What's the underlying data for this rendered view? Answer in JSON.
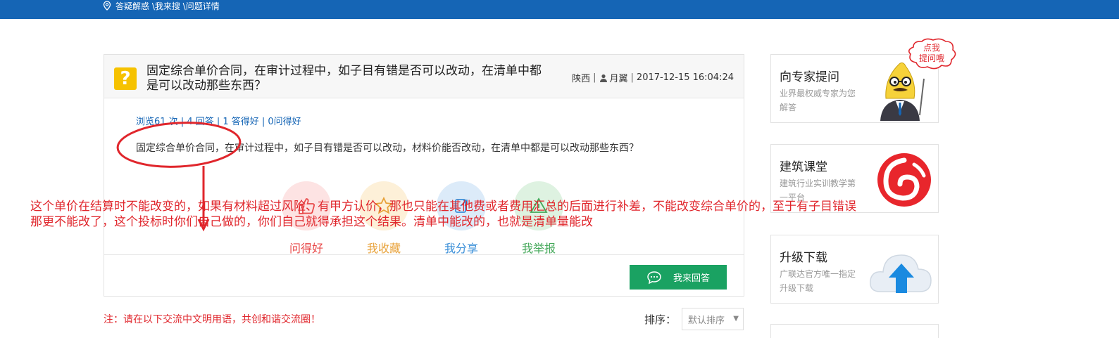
{
  "breadcrumb": {
    "text": "答疑解惑 \\我来搜 \\问题详情"
  },
  "question": {
    "title": "固定综合单价合同，在审计过程中，如子目有错是否可以改动，在清单中都是可以改动那些东西？",
    "region": "陕西",
    "user": "月翼",
    "datetime": "2017-12-15 16:04:24",
    "stats": "浏览61 次 | 4 回答 | 1 答得好 | 0问得好",
    "body": "固定综合单价合同，在审计过程中，如子目有错是否可以改动，材料价能否改动，在清单中都是可以改动那些东西？"
  },
  "actions": [
    {
      "label": "问得好",
      "icon": "thumbs-up-icon",
      "color": "#e84a4a",
      "bg": "#fde3e3"
    },
    {
      "label": "我收藏",
      "icon": "star-icon",
      "color": "#e8a23a",
      "bg": "#fdf0d8"
    },
    {
      "label": "我分享",
      "icon": "share-icon",
      "color": "#3a8fd8",
      "bg": "#dcebf9"
    },
    {
      "label": "我举报",
      "icon": "warning-icon",
      "color": "#45a85a",
      "bg": "#def2e1"
    }
  ],
  "answer_button": {
    "label": "我来回答",
    "icon": "chat-bubble-icon"
  },
  "notice": "注：请在以下交流中文明用语，共创和谐交流圈！",
  "sort": {
    "label": "排序：",
    "selected": "默认排序"
  },
  "sidebar": {
    "bubble": "点我\n提问哦",
    "cards": [
      {
        "title": "向专家提问",
        "subtitle": "业界最权威专家为您解答",
        "icon": "expert-mascot-icon"
      },
      {
        "title": "建筑课堂",
        "subtitle": "建筑行业实训教学第一平台",
        "icon": "glodon-logo-icon"
      },
      {
        "title": "升级下载",
        "subtitle": "广联达官方唯一指定升级下载",
        "icon": "cloud-upload-icon"
      }
    ]
  },
  "annotation": {
    "line1": "这个单价在结算时不能改变的，如果有材料超过风险、有甲方认价，那也只能在其他费或者费用汇总的后面进行补差，不能改变综合单价的，至于有子目错误",
    "line2": "那更不能改了，这个投标时你们自己做的，你们自己就得承担这个结果。清单中能改的，也就是清单量能改",
    "color": "#e0262c"
  },
  "colors": {
    "brand": "#1565b5",
    "answer_button": "#1aa262",
    "notice": "#e0262c"
  }
}
